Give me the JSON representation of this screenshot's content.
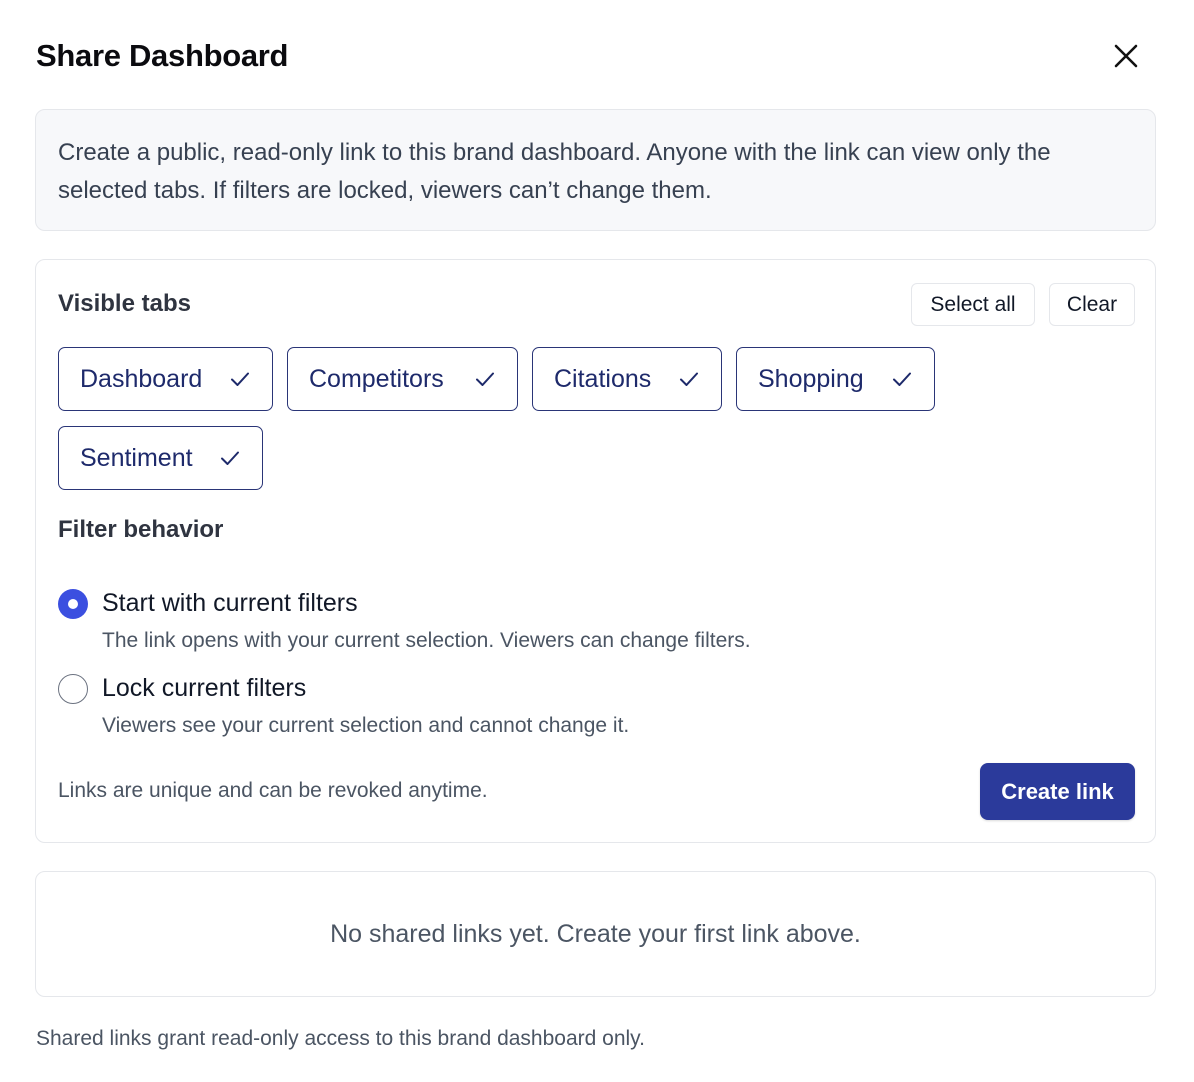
{
  "dialog": {
    "title": "Share Dashboard",
    "close_icon": "close-icon"
  },
  "info": {
    "text": "Create a public, read-only link to this brand dashboard. Anyone with the link can view only the selected tabs. If filters are locked, viewers can’t change them."
  },
  "visible_tabs": {
    "label": "Visible tabs",
    "select_all_label": "Select all",
    "clear_label": "Clear",
    "tabs": [
      {
        "label": "Dashboard",
        "selected": true,
        "icon": "check-icon"
      },
      {
        "label": "Competitors",
        "selected": true,
        "icon": "check-icon"
      },
      {
        "label": "Citations",
        "selected": true,
        "icon": "check-icon"
      },
      {
        "label": "Shopping",
        "selected": true,
        "icon": "check-icon"
      },
      {
        "label": "Sentiment",
        "selected": true,
        "icon": "check-icon"
      }
    ]
  },
  "filter_behavior": {
    "label": "Filter behavior",
    "options": [
      {
        "label": "Start with current filters",
        "description": "The link opens with your current selection. Viewers can change filters.",
        "selected": true
      },
      {
        "label": "Lock current filters",
        "description": "Viewers see your current selection and cannot change it.",
        "selected": false
      }
    ]
  },
  "footer": {
    "note": "Links are unique and can be revoked anytime.",
    "create_label": "Create link"
  },
  "shared_links": {
    "empty_text": "No shared links yet. Create your first link above."
  },
  "bottom_note": "Shared links grant read-only access to this brand dashboard only.",
  "colors": {
    "accent": "#3b4fe0",
    "primary_button": "#2b3a9b",
    "chip_border": "#2a3577",
    "chip_text": "#1e2a6b",
    "info_background": "#f7f8fa"
  }
}
